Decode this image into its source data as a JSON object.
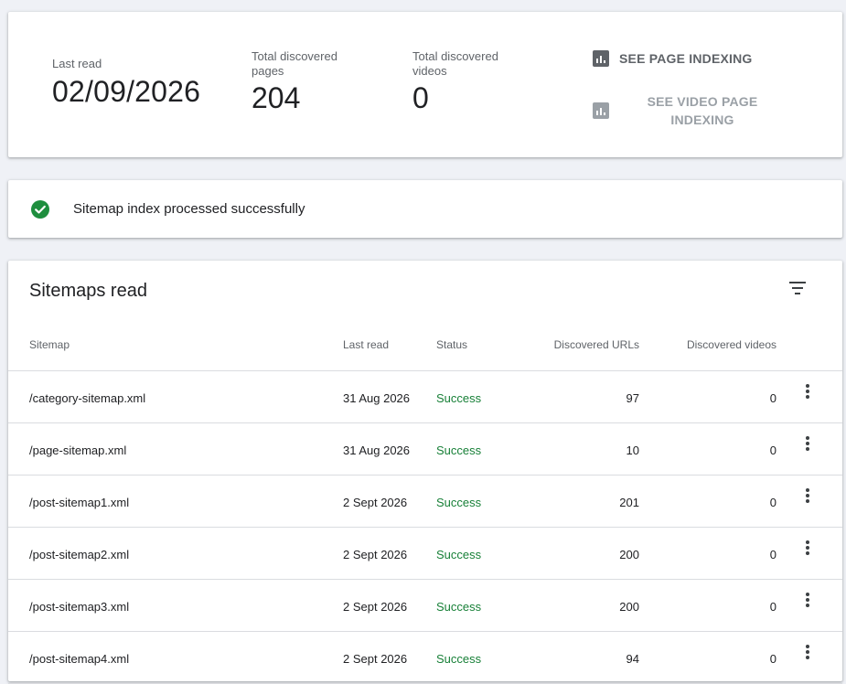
{
  "summary": {
    "last_read_label": "Last read",
    "last_read_value": "02/09/2026",
    "pages_label": "Total discovered pages",
    "pages_value": "204",
    "videos_label": "Total discovered videos",
    "videos_value": "0",
    "see_page_indexing": "SEE PAGE INDEXING",
    "see_video_page_indexing": "SEE VIDEO PAGE INDEXING"
  },
  "status": {
    "message": "Sitemap index processed successfully",
    "icon": "check-circle-icon",
    "color": "#1e8e3e"
  },
  "table": {
    "title": "Sitemaps read",
    "columns": {
      "sitemap": "Sitemap",
      "last_read": "Last read",
      "status": "Status",
      "discovered_urls": "Discovered URLs",
      "discovered_videos": "Discovered videos"
    },
    "rows": [
      {
        "sitemap": "/category-sitemap.xml",
        "last_read": "31 Aug 2026",
        "status": "Success",
        "urls": "97",
        "videos": "0"
      },
      {
        "sitemap": "/page-sitemap.xml",
        "last_read": "31 Aug 2026",
        "status": "Success",
        "urls": "10",
        "videos": "0"
      },
      {
        "sitemap": "/post-sitemap1.xml",
        "last_read": "2 Sept 2026",
        "status": "Success",
        "urls": "201",
        "videos": "0"
      },
      {
        "sitemap": "/post-sitemap2.xml",
        "last_read": "2 Sept 2026",
        "status": "Success",
        "urls": "200",
        "videos": "0"
      },
      {
        "sitemap": "/post-sitemap3.xml",
        "last_read": "2 Sept 2026",
        "status": "Success",
        "urls": "200",
        "videos": "0"
      },
      {
        "sitemap": "/post-sitemap4.xml",
        "last_read": "2 Sept 2026",
        "status": "Success",
        "urls": "94",
        "videos": "0"
      }
    ]
  },
  "colors": {
    "success": "#188038",
    "background": "#eff1f6"
  }
}
